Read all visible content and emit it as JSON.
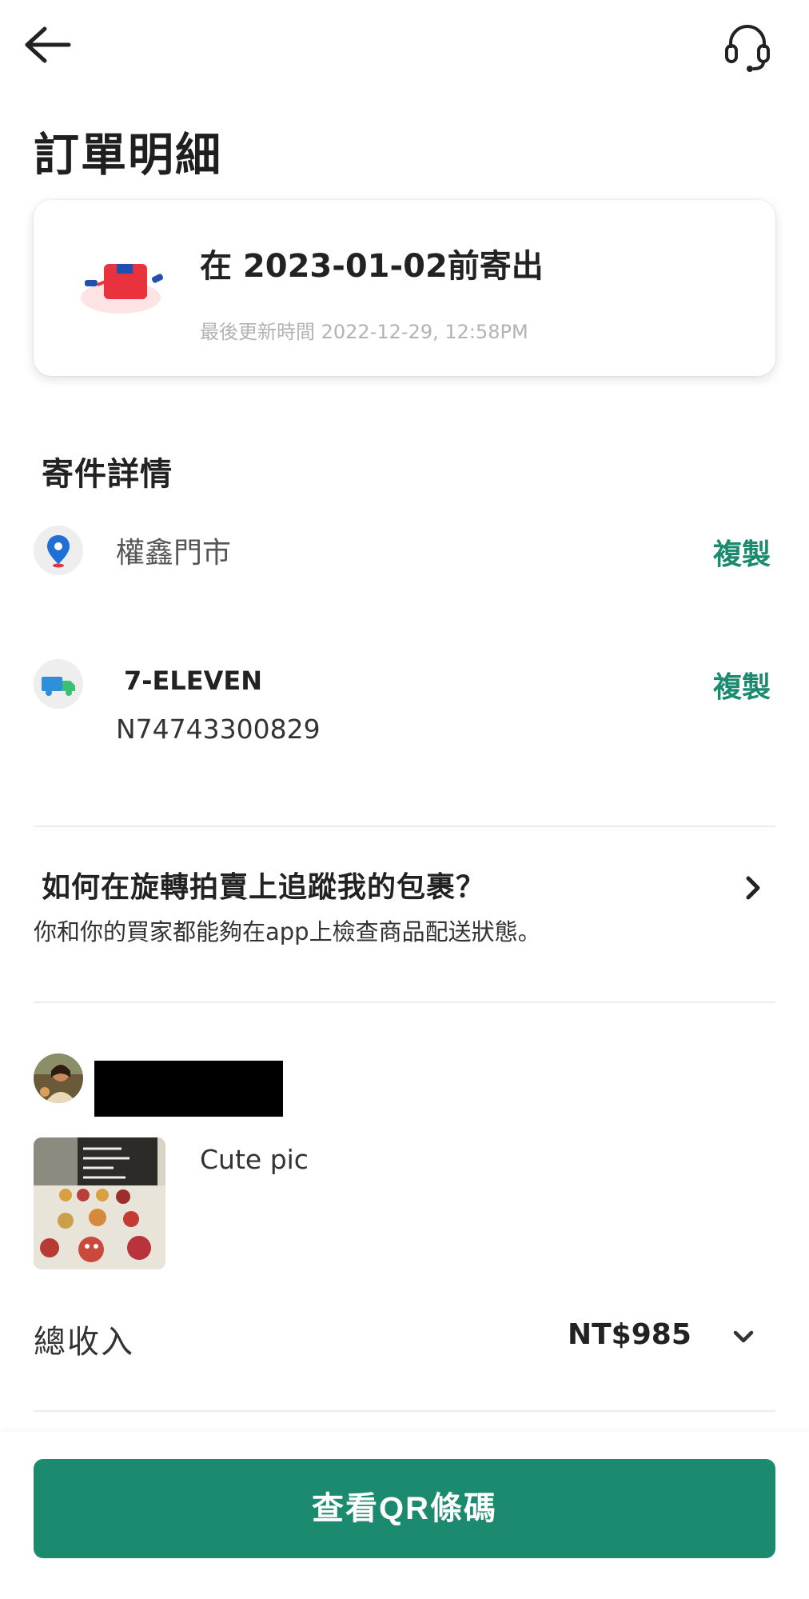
{
  "header": {
    "back_icon": "arrow-left-icon",
    "support_icon": "headset-icon",
    "title": "訂單明細"
  },
  "status_card": {
    "icon": "package-ship-icon",
    "title": "在 2023-01-02前寄出",
    "updated": "最後更新時間 2022-12-29, 12:58PM"
  },
  "shipping": {
    "section_title": "寄件詳情",
    "store": {
      "icon": "location-pin-icon",
      "name": "權鑫門市",
      "copy_label": "複製"
    },
    "carrier": {
      "icon": "truck-icon",
      "name": "7-ELEVEN",
      "tracking_number": "N74743300829",
      "copy_label": "複製"
    }
  },
  "help": {
    "title": "如何在旋轉拍賣上追蹤我的包裹？",
    "description": "你和你的買家都能夠在app上檢查商品配送狀態。",
    "icon": "chevron-right-icon"
  },
  "order": {
    "product_name": "Cute pic"
  },
  "income": {
    "label": "總收入",
    "value": "NT$985",
    "toggle_icon": "chevron-down-icon"
  },
  "footer": {
    "qr_button_label": "查看QR條碼"
  },
  "colors": {
    "accent": "#1b8a6e",
    "text_primary": "#222222",
    "text_muted": "#b3b3b3",
    "divider": "#ececec",
    "icon_pin": "#1f6fd6",
    "icon_truck": "#2f8fd8",
    "icon_truck_cab": "#3cbf74",
    "icon_package": "#e8333f"
  }
}
